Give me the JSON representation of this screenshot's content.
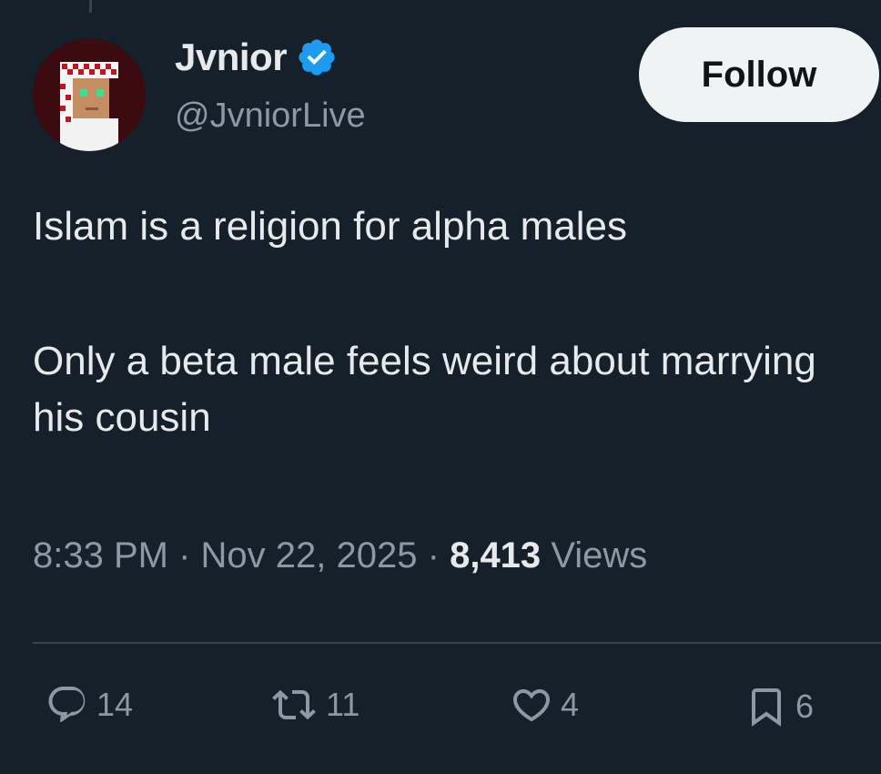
{
  "author": {
    "display_name": "Jvnior",
    "handle": "@JvniorLive",
    "verified": true,
    "verified_color": "#1d9bf0"
  },
  "follow_button": {
    "label": "Follow"
  },
  "tweet": {
    "paragraphs": [
      "Islam is a religion for alpha males",
      "Only a beta male feels weird about marrying his cousin"
    ],
    "time": "8:33 PM",
    "separator": "·",
    "date": "Nov 22, 2025",
    "views_count": "8,413",
    "views_label": "Views"
  },
  "actions": {
    "replies": {
      "icon": "reply-icon",
      "count": "14"
    },
    "retweets": {
      "icon": "retweet-icon",
      "count": "11"
    },
    "likes": {
      "icon": "heart-icon",
      "count": "4"
    },
    "bookmarks": {
      "icon": "bookmark-icon",
      "count": "6"
    }
  },
  "colors": {
    "background": "#15202b",
    "text": "#e7e9ea",
    "secondary_text": "#8b98a5",
    "divider": "#38444d"
  }
}
